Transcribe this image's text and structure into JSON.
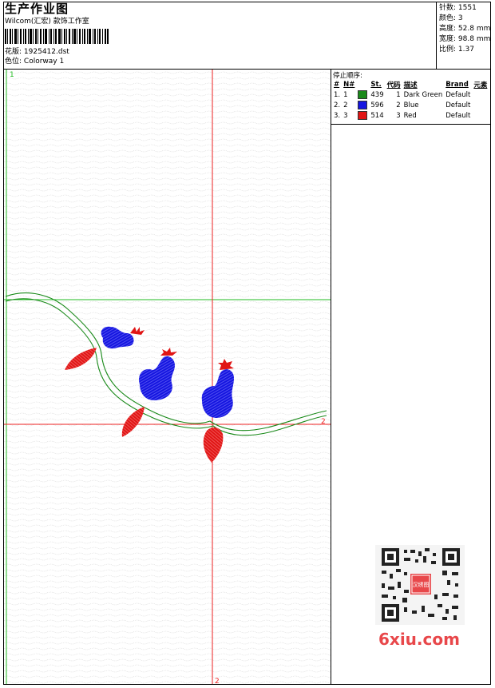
{
  "header": {
    "title": "生产作业图",
    "company": "Wilcom(汇宏) 款饰工作室",
    "design_label": "花版:",
    "design_value": "1925412.dst",
    "colorway_label": "色位:",
    "colorway_value": "Colorway 1"
  },
  "stats": {
    "stitches_label": "针数:",
    "stitches_value": "1551",
    "colors_label": "颜色:",
    "colors_value": "3",
    "height_label": "高度:",
    "height_value": "52.8 mm",
    "width_label": "宽度:",
    "width_value": "98.8 mm",
    "ratio_label": "比例:",
    "ratio_value": "1.37"
  },
  "stop_sequence": {
    "title": "停止顺序:",
    "columns": [
      "#",
      "N#",
      "St.",
      "代码",
      "描述",
      "Brand",
      "元素"
    ],
    "rows": [
      {
        "seq": "1.",
        "n": "1",
        "color": "#1a8a1a",
        "st": "439",
        "code": "1",
        "desc": "Dark Green",
        "brand": "Default"
      },
      {
        "seq": "2.",
        "n": "2",
        "color": "#1515e0",
        "st": "596",
        "code": "2",
        "desc": "Blue",
        "brand": "Default"
      },
      {
        "seq": "3.",
        "n": "3",
        "color": "#e01515",
        "st": "514",
        "code": "3",
        "desc": "Red",
        "brand": "Default"
      }
    ]
  },
  "guides": {
    "v1_label": "1",
    "h2_label": "2",
    "v2_label": "2"
  },
  "watermark": {
    "seal_text": "汉绣图",
    "site": "6xiu.com"
  },
  "colors": {
    "green": "#1a8a1a",
    "blue": "#1515e0",
    "red": "#e01515",
    "guide_green": "#22bb22",
    "guide_red": "#ee2222"
  }
}
